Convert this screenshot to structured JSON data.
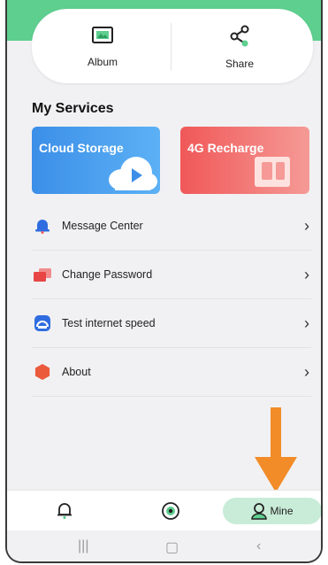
{
  "quick_actions": {
    "album_label": "Album",
    "share_label": "Share"
  },
  "services": {
    "title": "My Services",
    "cloud_label": "Cloud Storage",
    "recharge_label": "4G Recharge"
  },
  "menu": [
    {
      "label": "Message Center",
      "icon": "bell-icon"
    },
    {
      "label": "Change Password",
      "icon": "password-icon"
    },
    {
      "label": "Test internet speed",
      "icon": "speedometer-icon"
    },
    {
      "label": "About",
      "icon": "hexagon-icon"
    }
  ],
  "tabbar": {
    "mine_label": "Mine"
  },
  "colors": {
    "accent_green": "#5ecf8f",
    "mine_tab_bg": "#c9ecd8",
    "cloud_blue": "#3c8fe8",
    "recharge_red": "#f05858",
    "arrow_orange": "#f28c28"
  }
}
